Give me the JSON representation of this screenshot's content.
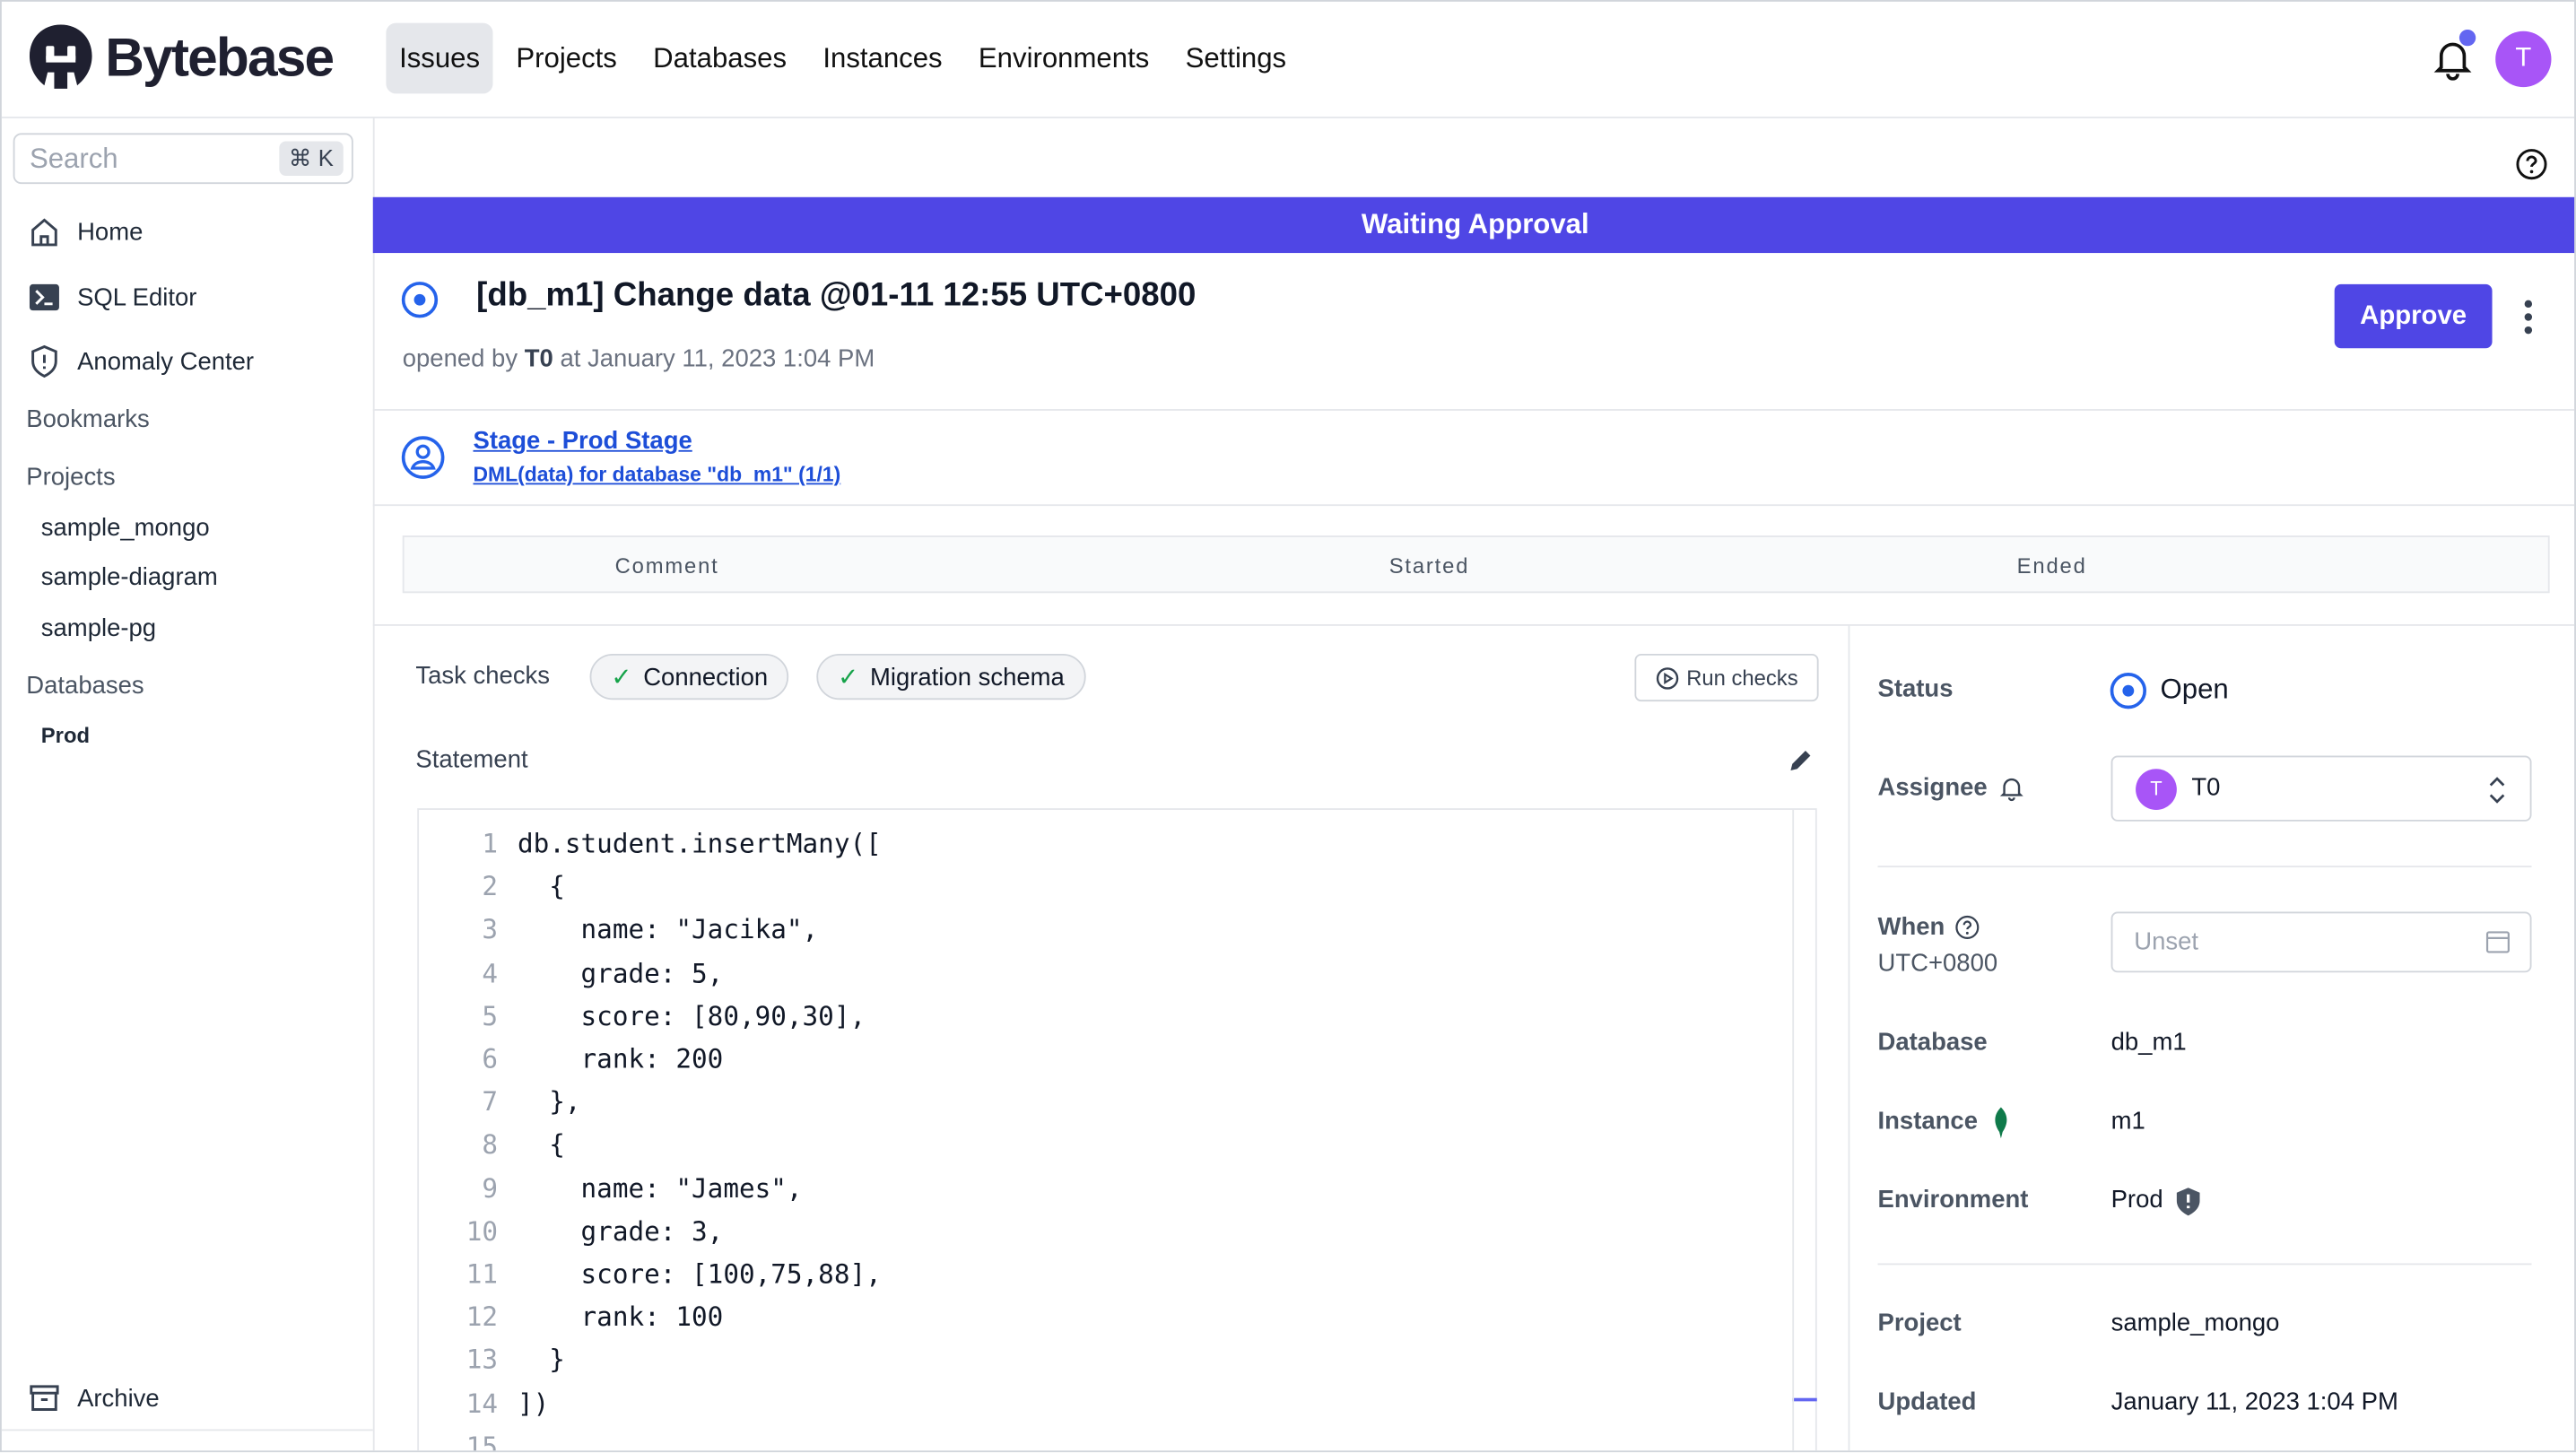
{
  "brand": {
    "name": "Bytebase"
  },
  "nav": {
    "items": [
      {
        "label": "Issues",
        "active": true
      },
      {
        "label": "Projects"
      },
      {
        "label": "Databases"
      },
      {
        "label": "Instances"
      },
      {
        "label": "Environments"
      },
      {
        "label": "Settings"
      }
    ],
    "avatar_initial": "T"
  },
  "sidebar": {
    "search": {
      "placeholder": "Search",
      "shortcut": "⌘ K"
    },
    "items": [
      {
        "label": "Home",
        "icon": "home-icon"
      },
      {
        "label": "SQL Editor",
        "icon": "terminal-icon"
      },
      {
        "label": "Anomaly Center",
        "icon": "shield-icon"
      }
    ],
    "bookmarks": "Bookmarks",
    "projects_label": "Projects",
    "projects": [
      "sample_mongo",
      "sample-diagram",
      "sample-pg"
    ],
    "databases_label": "Databases",
    "databases": [
      "Prod"
    ],
    "archive": "Archive"
  },
  "banner": {
    "text": "Waiting Approval",
    "color": "#4f46e5"
  },
  "issue": {
    "title": "[db_m1] Change data @01-11 12:55 UTC+0800",
    "opened_prefix": "opened by",
    "creator": "T0",
    "opened_suffix": "at January 11, 2023 1:04 PM",
    "approve_label": "Approve",
    "stage_link": "Stage - Prod Stage",
    "task_link": "DML(data) for database \"db_m1\" (1/1)"
  },
  "table": {
    "columns": [
      "Comment",
      "Started",
      "Ended"
    ]
  },
  "checks": {
    "label": "Task checks",
    "items": [
      "Connection",
      "Migration schema"
    ],
    "run_label": "Run checks"
  },
  "statement": {
    "label": "Statement",
    "lines": [
      "db.student.insertMany([",
      "  {",
      "    name: \"Jacika\",",
      "    grade: 5,",
      "    score: [80,90,30],",
      "    rank: 200",
      "  },",
      "  {",
      "    name: \"James\",",
      "    grade: 3,",
      "    score: [100,75,88],",
      "    rank: 100",
      "  }",
      "])",
      ""
    ]
  },
  "details": {
    "status_label": "Status",
    "status_value": "Open",
    "assignee_label": "Assignee",
    "assignee_value": "T0",
    "assignee_initial": "T",
    "when_label": "When",
    "when_tz": "UTC+0800",
    "when_placeholder": "Unset",
    "database_label": "Database",
    "database_value": "db_m1",
    "instance_label": "Instance",
    "instance_value": "m1",
    "environment_label": "Environment",
    "environment_value": "Prod",
    "project_label": "Project",
    "project_value": "sample_mongo",
    "updated_label": "Updated",
    "updated_value": "January 11, 2023 1:04 PM"
  }
}
